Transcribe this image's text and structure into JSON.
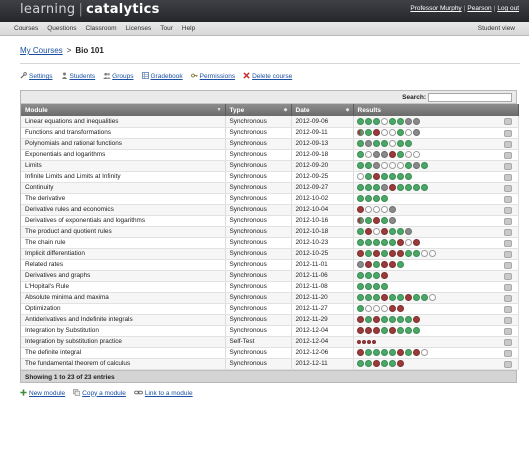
{
  "header": {
    "brand_left": "learning",
    "brand_right": "catalytics",
    "user_name": "Professor Murphy",
    "org": "Pearson",
    "logout": "Log out",
    "separator": "|"
  },
  "menu": {
    "items": [
      "Courses",
      "Questions",
      "Classroom",
      "Licenses",
      "Tour",
      "Help"
    ],
    "student_view": "Student view"
  },
  "breadcrumb": {
    "parent": "My Courses",
    "sep": ">",
    "current": "Bio 101"
  },
  "actions": [
    {
      "label": "Settings",
      "icon": "wrench-icon"
    },
    {
      "label": "Students",
      "icon": "person-icon"
    },
    {
      "label": "Groups",
      "icon": "group-icon"
    },
    {
      "label": "Gradebook",
      "icon": "gradebook-icon"
    },
    {
      "label": "Permissions",
      "icon": "key-icon"
    },
    {
      "label": "Delete course",
      "icon": "delete-x-icon"
    }
  ],
  "search": {
    "label": "Search:",
    "value": ""
  },
  "table": {
    "columns": [
      "Module",
      "Type",
      "Date",
      "Results"
    ],
    "rows": [
      {
        "module": "Linear equations and inequalities",
        "type": "Synchronous",
        "date": "2012-09-06",
        "results": [
          "g",
          "g",
          "g",
          "w",
          "g",
          "g",
          "gy",
          "gy"
        ]
      },
      {
        "module": "Functions and transformations",
        "type": "Synchronous",
        "date": "2012-09-11",
        "results": [
          "mx",
          "g",
          "r",
          "w",
          "w",
          "g",
          "w",
          "gy"
        ]
      },
      {
        "module": "Polynomials and rational functions",
        "type": "Synchronous",
        "date": "2012-09-13",
        "results": [
          "g",
          "gy",
          "g",
          "g",
          "w",
          "g",
          "g"
        ]
      },
      {
        "module": "Exponentials and logarithms",
        "type": "Synchronous",
        "date": "2012-09-18",
        "results": [
          "g",
          "w",
          "gy",
          "gy",
          "r",
          "g",
          "w",
          "w"
        ]
      },
      {
        "module": "Limits",
        "type": "Synchronous",
        "date": "2012-09-20",
        "results": [
          "g",
          "g",
          "gy",
          "w",
          "w",
          "w",
          "g",
          "gy",
          "g"
        ]
      },
      {
        "module": "Infinite Limits and Limits at Infinity",
        "type": "Synchronous",
        "date": "2012-09-25",
        "results": [
          "w",
          "g",
          "r",
          "g",
          "g",
          "g",
          "g"
        ]
      },
      {
        "module": "Continuity",
        "type": "Synchronous",
        "date": "2012-09-27",
        "results": [
          "g",
          "g",
          "g",
          "gy",
          "r",
          "g",
          "g",
          "g",
          "g"
        ]
      },
      {
        "module": "The derivative",
        "type": "Synchronous",
        "date": "2012-10-02",
        "results": [
          "g",
          "g",
          "g",
          "g"
        ]
      },
      {
        "module": "Derivative rules and economics",
        "type": "Synchronous",
        "date": "2012-10-04",
        "results": [
          "r",
          "w",
          "w",
          "w",
          "gy"
        ]
      },
      {
        "module": "Derivatives of exponentials and logarithms",
        "type": "Synchronous",
        "date": "2012-10-16",
        "results": [
          "mx",
          "g",
          "r",
          "g",
          "gy"
        ]
      },
      {
        "module": "The product and quotient rules",
        "type": "Synchronous",
        "date": "2012-10-18",
        "results": [
          "g",
          "r",
          "w",
          "r",
          "g",
          "g",
          "gy"
        ]
      },
      {
        "module": "The chain rule",
        "type": "Synchronous",
        "date": "2012-10-23",
        "results": [
          "g",
          "g",
          "g",
          "g",
          "g",
          "r",
          "w",
          "r"
        ]
      },
      {
        "module": "Implicit differentiation",
        "type": "Synchronous",
        "date": "2012-10-25",
        "results": [
          "r",
          "g",
          "r",
          "g",
          "r",
          "r",
          "g",
          "g",
          "w",
          "w"
        ]
      },
      {
        "module": "Related rates",
        "type": "Synchronous",
        "date": "2012-11-01",
        "results": [
          "gy",
          "r",
          "g",
          "r",
          "r",
          "g"
        ]
      },
      {
        "module": "Derivatives and graphs",
        "type": "Synchronous",
        "date": "2012-11-06",
        "results": [
          "g",
          "g",
          "g",
          "r"
        ]
      },
      {
        "module": "L'Hopital's Rule",
        "type": "Synchronous",
        "date": "2012-11-08",
        "results": [
          "g",
          "g",
          "g",
          "g"
        ]
      },
      {
        "module": "Absolute minima and maxima",
        "type": "Synchronous",
        "date": "2012-11-20",
        "results": [
          "g",
          "g",
          "g",
          "r",
          "g",
          "g",
          "r",
          "g",
          "g",
          "w"
        ]
      },
      {
        "module": "Optimization",
        "type": "Synchronous",
        "date": "2012-11-27",
        "results": [
          "g",
          "w",
          "w",
          "w",
          "r",
          "r"
        ]
      },
      {
        "module": "Antiderivatives and Indefinite integrals",
        "type": "Synchronous",
        "date": "2012-11-29",
        "results": [
          "r",
          "g",
          "r",
          "g",
          "g",
          "g",
          "g",
          "r"
        ]
      },
      {
        "module": "Integration by Substitution",
        "type": "Synchronous",
        "date": "2012-12-04",
        "results": [
          "r",
          "r",
          "r",
          "g",
          "r",
          "g",
          "g",
          "g"
        ]
      },
      {
        "module": "Integration by substitution practice",
        "type": "Self-Test",
        "date": "2012-12-04",
        "results": [
          "r",
          "r",
          "r",
          "r"
        ],
        "small": true
      },
      {
        "module": "The definite integral",
        "type": "Synchronous",
        "date": "2012-12-06",
        "results": [
          "r",
          "g",
          "g",
          "g",
          "g",
          "r",
          "g",
          "r",
          "w"
        ]
      },
      {
        "module": "The fundamental theorem of calculus",
        "type": "Synchronous",
        "date": "2012-12-11",
        "results": [
          "g",
          "g",
          "r",
          "g",
          "g",
          "r"
        ]
      }
    ]
  },
  "footer": {
    "entries_text": "Showing 1 to 23 of 23 entries"
  },
  "bottom_links": [
    {
      "label": "New module",
      "icon": "plus-icon"
    },
    {
      "label": "Copy a module",
      "icon": "copy-icon"
    },
    {
      "label": "Link to a module",
      "icon": "link-icon"
    }
  ],
  "colors": {
    "correct": "#4aa867",
    "incorrect": "#9b3a3a",
    "partial": "#8a8a8a",
    "link": "#1a4fa3"
  }
}
